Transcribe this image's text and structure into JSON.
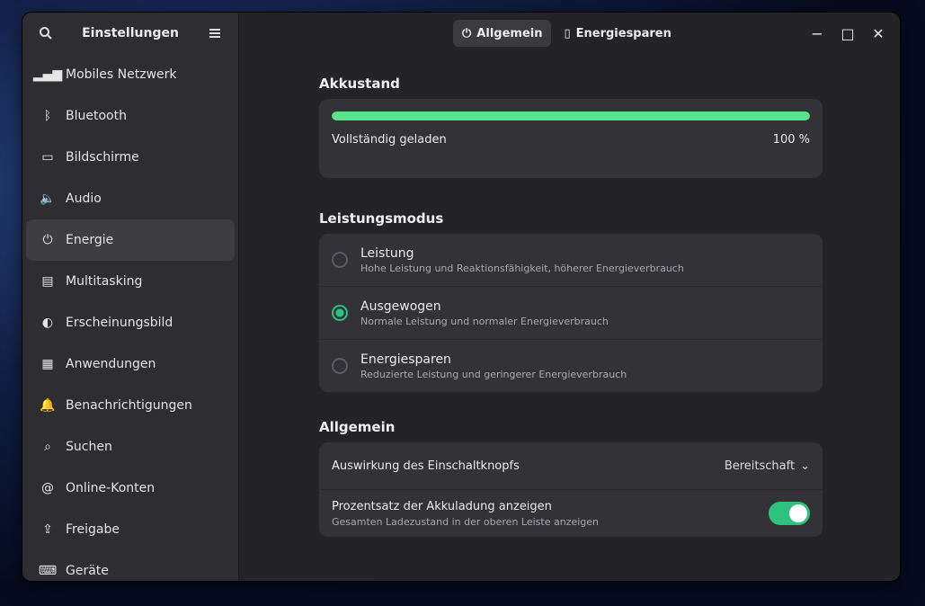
{
  "sidebar": {
    "title": "Einstellungen",
    "items": [
      {
        "label": "Mobiles Netzwerk",
        "icon": "signal-icon"
      },
      {
        "label": "Bluetooth",
        "icon": "bluetooth-icon"
      },
      {
        "label": "Bildschirme",
        "icon": "display-icon"
      },
      {
        "label": "Audio",
        "icon": "speaker-icon"
      },
      {
        "label": "Energie",
        "icon": "power-icon",
        "active": true
      },
      {
        "label": "Multitasking",
        "icon": "multitasking-icon"
      },
      {
        "label": "Erscheinungsbild",
        "icon": "appearance-icon"
      },
      {
        "label": "Anwendungen",
        "icon": "apps-icon"
      },
      {
        "label": "Benachrichtigungen",
        "icon": "bell-icon"
      },
      {
        "label": "Suchen",
        "icon": "search-icon"
      },
      {
        "label": "Online-Konten",
        "icon": "accounts-icon"
      },
      {
        "label": "Freigabe",
        "icon": "share-icon"
      },
      {
        "label": "Geräte",
        "icon": "devices-icon"
      }
    ]
  },
  "header": {
    "tabs": [
      {
        "label": "Allgemein",
        "icon": "power-icon"
      },
      {
        "label": "Energiesparen",
        "icon": "battery-icon"
      }
    ]
  },
  "battery": {
    "heading": "Akkustand",
    "status": "Vollständig geladen",
    "percent_label": "100 %",
    "level": 1.0
  },
  "power_mode": {
    "heading": "Leistungsmodus",
    "profiles": [
      {
        "title": "Leistung",
        "sub": "Hohe Leistung und Reaktionsfähigkeit, höherer Energieverbrauch",
        "selected": false
      },
      {
        "title": "Ausgewogen",
        "sub": "Normale Leistung und normaler Energieverbrauch",
        "selected": true
      },
      {
        "title": "Energiesparen",
        "sub": "Reduzierte Leistung und geringerer Energieverbrauch",
        "selected": false
      }
    ]
  },
  "general": {
    "heading": "Allgemein",
    "power_button_label": "Auswirkung des Einschaltknopfs",
    "power_button_value": "Bereitschaft",
    "percent_label": "Prozentsatz der Akkuladung anzeigen",
    "percent_sub": "Gesamten Ladezustand in der oberen Leiste anzeigen",
    "percent_on": true
  },
  "colors": {
    "accent": "#2ec27e",
    "bar": "#57e389"
  }
}
